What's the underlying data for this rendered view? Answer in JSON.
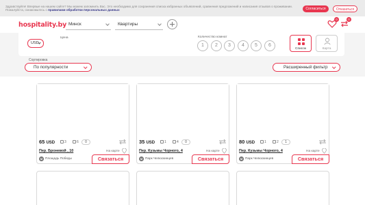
{
  "cookie": {
    "text": "Здравствуйте! Впервые на нашем сайте? Мы можем запомнить Вас. Это необходимо для сохранения списка избранных объявлений, сравнения предложений и написания отзывов о проживании. Пожалуйста, ознакомьтесь с",
    "link": "правилами обработки персональных данных",
    "agree": "Согласиться",
    "decline": "Отказаться"
  },
  "header": {
    "logo": "hospitality.by",
    "city": "Минск",
    "type": "Квартиры",
    "favorites_count": "0",
    "compare_count": "0"
  },
  "filter": {
    "price_label": "Цена",
    "currency": "USD",
    "rooms_label": "Количество комнат",
    "rooms": [
      "1",
      "2",
      "3",
      "4",
      "5",
      "6"
    ],
    "view_list": "Список",
    "view_map": "Карта"
  },
  "sort": {
    "label": "Сортировка",
    "value": "По популярности",
    "extended": "Расширенный фильтр"
  },
  "listings": [
    {
      "price": "65",
      "currency": "USD",
      "rooms": "3",
      "beds": "6",
      "count": "0",
      "street": "Пер. Броневой , 10",
      "on_map": "На карте",
      "metro": "Площадь Победы",
      "contact": "Связаться"
    },
    {
      "price": "35",
      "currency": "USD",
      "rooms": "1",
      "beds": "4",
      "count": "0",
      "street": "Пер. Кузьмы Чорного, 4",
      "on_map": "На карте",
      "metro": "Парк Челюскинцев",
      "contact": "Связаться"
    },
    {
      "price": "80",
      "currency": "USD",
      "rooms": "1",
      "beds": "2",
      "count": "1",
      "street": "Пер. Кузьмы Чорного, 4",
      "on_map": "На карте",
      "metro": "Парк Челюскинцев",
      "contact": "Связаться"
    }
  ],
  "colors": {
    "accent": "#e8364f"
  }
}
